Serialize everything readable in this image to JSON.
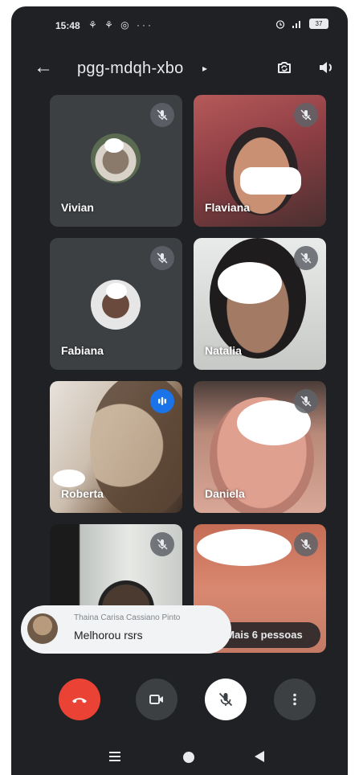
{
  "status_bar": {
    "time": "15:48",
    "left_icons": "⚘ ⚘ ◎ ···",
    "battery": "37"
  },
  "header": {
    "meeting_code": "pgg-mdqh-xbo",
    "caret": "▸",
    "back_icon": "←"
  },
  "participants": [
    {
      "name": "Vivian",
      "mic": "muted",
      "video": "off"
    },
    {
      "name": "Flaviana",
      "mic": "muted",
      "video": "on"
    },
    {
      "name": "Fabiana",
      "mic": "muted",
      "video": "off"
    },
    {
      "name": "Natalia",
      "mic": "muted",
      "video": "on"
    },
    {
      "name": "Roberta",
      "mic": "speaking",
      "video": "on"
    },
    {
      "name": "Daniela",
      "mic": "muted",
      "video": "on"
    },
    {
      "name": "",
      "mic": "muted",
      "video": "on"
    },
    {
      "name": "",
      "mic": "muted",
      "video": "on"
    }
  ],
  "chat_toast": {
    "sender": "Thaina Carisa Cassiano Pinto",
    "message": "Melhorou rsrs"
  },
  "more_people": "Mais 6 pessoas",
  "controls": [
    "end-call",
    "camera",
    "microphone-muted",
    "more-options"
  ],
  "colors": {
    "background": "#202124",
    "tile": "#3c4043",
    "end_call": "#ea4335",
    "speaking": "#1a73e8"
  }
}
